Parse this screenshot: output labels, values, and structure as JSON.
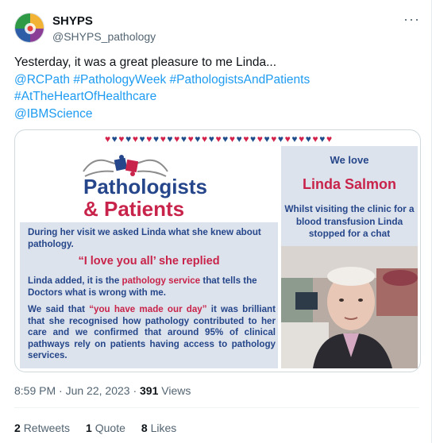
{
  "author": {
    "name": "SHYPS",
    "handle": "@SHYPS_pathology"
  },
  "more_icon": "more-horizontal-icon",
  "tweet": {
    "text": "Yesterday, it was a great pleasure to me Linda...",
    "line2": [
      "@RCPath",
      "#PathologyWeek",
      "#PathologistsAndPatients"
    ],
    "line3": "#AtTheHeartOfHealthcare",
    "line4": "@IBMScience"
  },
  "image": {
    "logo_title_line1": "Pathologists",
    "logo_title_line2": "& Patients",
    "p1": "During her visit we asked Linda what she knew about pathology.",
    "quote": "“I love you all’ she replied",
    "p2_a": "Linda added, it is the ",
    "p2_b": "pathology service",
    "p2_c": " that tells the Doctors what is wrong with me.",
    "p3_a": "We said that ",
    "p3_b": "“you have made our day”",
    "p3_c": " it was brilliant that she recognised how pathology contributed to her care and we confirmed that around 95% of clinical pathways rely on patients having access to pathology services.",
    "we_love": "We love",
    "name": "Linda Salmon",
    "desc": "Whilst visiting the clinic for a blood transfusion Linda stopped for a chat"
  },
  "meta": {
    "time": "8:59 PM",
    "separator": "·",
    "date": "Jun 22, 2023",
    "views_count": "391",
    "views_label": "Views"
  },
  "stats": {
    "retweets_count": "2",
    "retweets_label": "Retweets",
    "quotes_count": "1",
    "quotes_label": "Quote",
    "likes_count": "8",
    "likes_label": "Likes"
  },
  "colors": {
    "link": "#1d9bf0",
    "navy": "#25468a",
    "brand_red": "#c8234a"
  }
}
